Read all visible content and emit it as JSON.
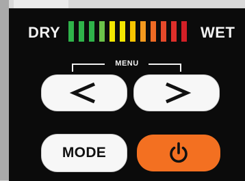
{
  "meter": {
    "dry_label": "DRY",
    "wet_label": "WET",
    "bar_colors": [
      "#2fb34a",
      "#2fb34a",
      "#2fb34a",
      "#6cc24a",
      "#f2e600",
      "#f2e600",
      "#f6c400",
      "#f39a1e",
      "#ee6a24",
      "#e5492a",
      "#dd2f2a",
      "#d21f26"
    ]
  },
  "menu": {
    "label": "MENU",
    "prev_icon": "chevron-left-icon",
    "next_icon": "chevron-right-icon"
  },
  "controls": {
    "mode_label": "MODE",
    "power_icon": "power-icon",
    "power_color": "#f37021"
  }
}
